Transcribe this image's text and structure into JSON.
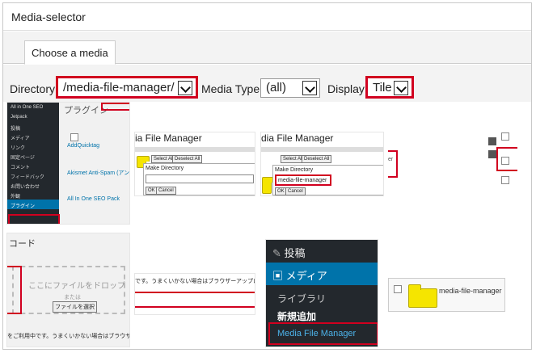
{
  "window": {
    "title": "Media-selector"
  },
  "tabs": [
    {
      "label": "Choose a media"
    }
  ],
  "controls": {
    "directory_label": "Directory",
    "directory_value": "/media-file-manager/",
    "media_type_label": "Media Type:",
    "media_type_value": "(all)",
    "display_label": "Display:",
    "display_value": "Tile"
  },
  "thumbs": {
    "t1": {
      "heading": "プラグイン",
      "sidebar": [
        "All in One SEO",
        "Jetpack",
        "投稿",
        "メディア",
        "リンク",
        "固定ページ",
        "コメント",
        "フィードバック",
        "お問い合わせ",
        "外観",
        "プラグイン"
      ],
      "plugins": [
        "AddQuicktag",
        "Akismet Anti-Spam (アン",
        "All In One SEO Pack"
      ]
    },
    "t2": {
      "title": "ia File Manager",
      "make_dir": "Make Directory",
      "ok": "OK",
      "cancel": "Cancel"
    },
    "t3": {
      "title": "dia File Manager",
      "make_dir": "Make Directory",
      "value": "media-file-manager",
      "ok": "OK",
      "cancel": "Cancel"
    },
    "t5": {
      "heading": "コード",
      "drop": "ここにファイルをドロップ",
      "or": "または",
      "select": "ファイルを選択",
      "note": "です。うまくいかない場合はブラウザーアップローダーをお試",
      "note2": "をご利用中です。うまくいかない場合はブラウザーアップロ"
    },
    "t7": {
      "posts": "投稿",
      "media": "メディア",
      "library": "ライブラリ",
      "add_new": "新規追加",
      "mfm": "Media File Manager"
    },
    "t8": {
      "folder_label": "media-file-manager"
    }
  }
}
